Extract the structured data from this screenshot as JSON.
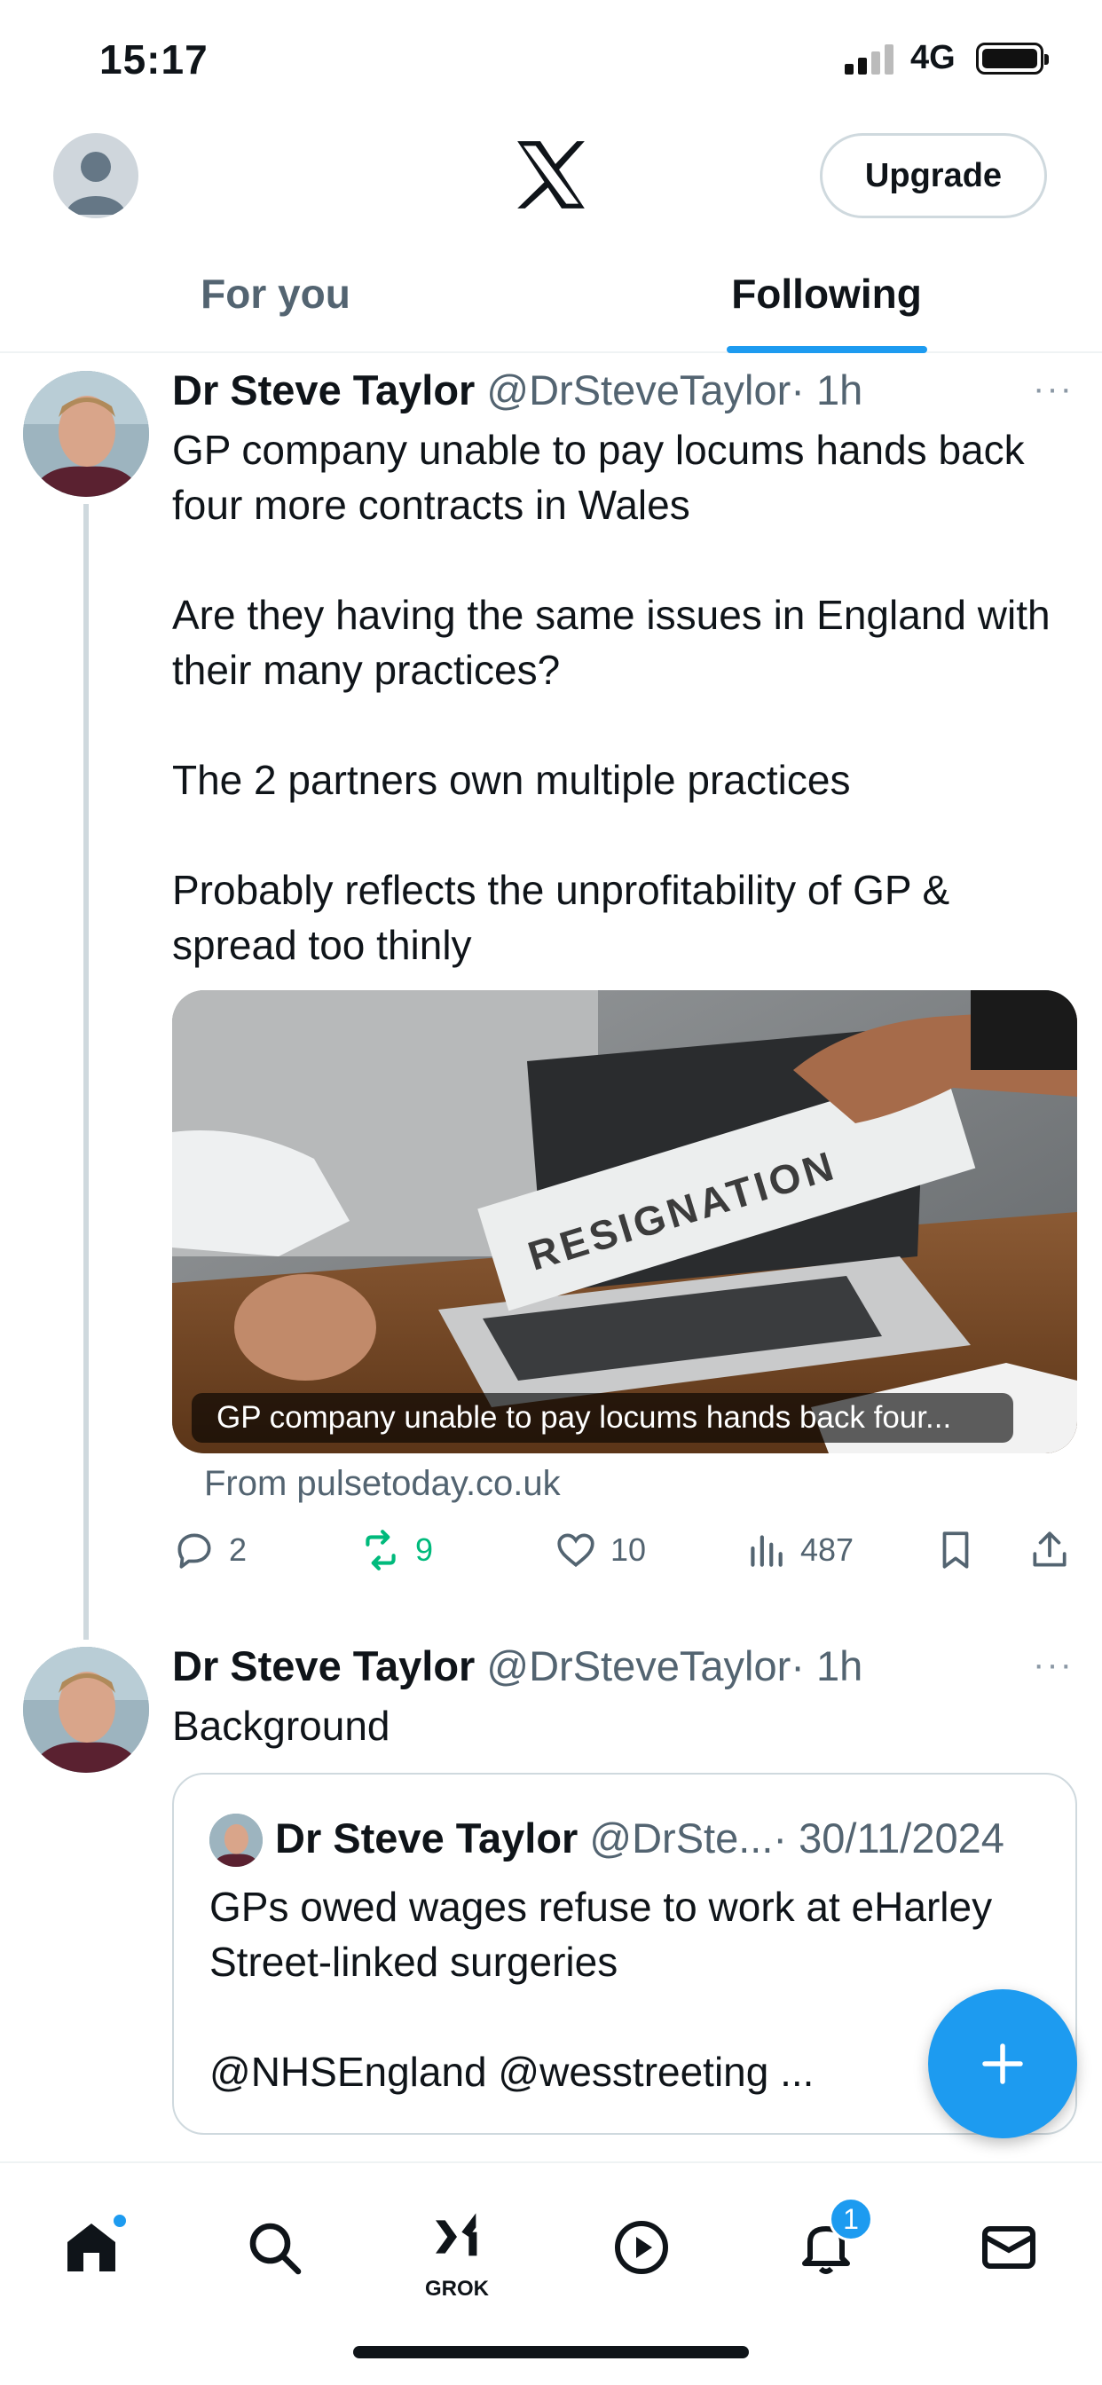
{
  "status_bar": {
    "time": "15:17",
    "network": "4G",
    "signal_icon": "signal-bars-icon",
    "battery_icon": "battery-icon"
  },
  "header": {
    "logo_icon": "x-logo-icon",
    "upgrade_label": "Upgrade",
    "avatar_icon": "default-avatar-icon"
  },
  "tabs": [
    {
      "label": "For you",
      "active": false
    },
    {
      "label": "Following",
      "active": true
    }
  ],
  "posts": [
    {
      "name": "Dr Steve Taylor",
      "handle": "@DrSteveTaylor",
      "time": "· 1h",
      "more": "···",
      "text": "GP company unable to pay locums hands back four more contracts in Wales\n\nAre they having the same issues in England with their many practices?\n\nThe 2 partners own multiple practices\n\nProbably reflects the unprofitability of GP & spread too thinly",
      "media": {
        "image_text": "RESIGNATION",
        "caption": "GP company unable to pay locums hands back four...",
        "source": "From pulsetoday.co.uk"
      },
      "actions": {
        "replies": "2",
        "reposts": "9",
        "likes": "10",
        "views": "487"
      }
    },
    {
      "name": "Dr Steve Taylor",
      "handle": "@DrSteveTaylor",
      "time": "· 1h",
      "more": "···",
      "text": "Background",
      "quote": {
        "name": "Dr Steve Taylor",
        "handle": "@DrSte...",
        "date": "· 30/11/2024",
        "text": "GPs owed wages refuse to work at eHarley Street-linked surgeries\n\n@NHSEngland @wesstreeting ..."
      }
    }
  ],
  "nav": {
    "grok_label": "GROK",
    "notification_count": "1",
    "icons": [
      "home-icon",
      "search-icon",
      "grok-icon",
      "video-play-icon",
      "notifications-bell-icon",
      "messages-mail-icon"
    ]
  },
  "colors": {
    "accent": "#1d9bf0",
    "text_primary": "#0f1419",
    "text_secondary": "#536471",
    "repost_green": "#00ba7c",
    "border": "#cfd9de"
  }
}
